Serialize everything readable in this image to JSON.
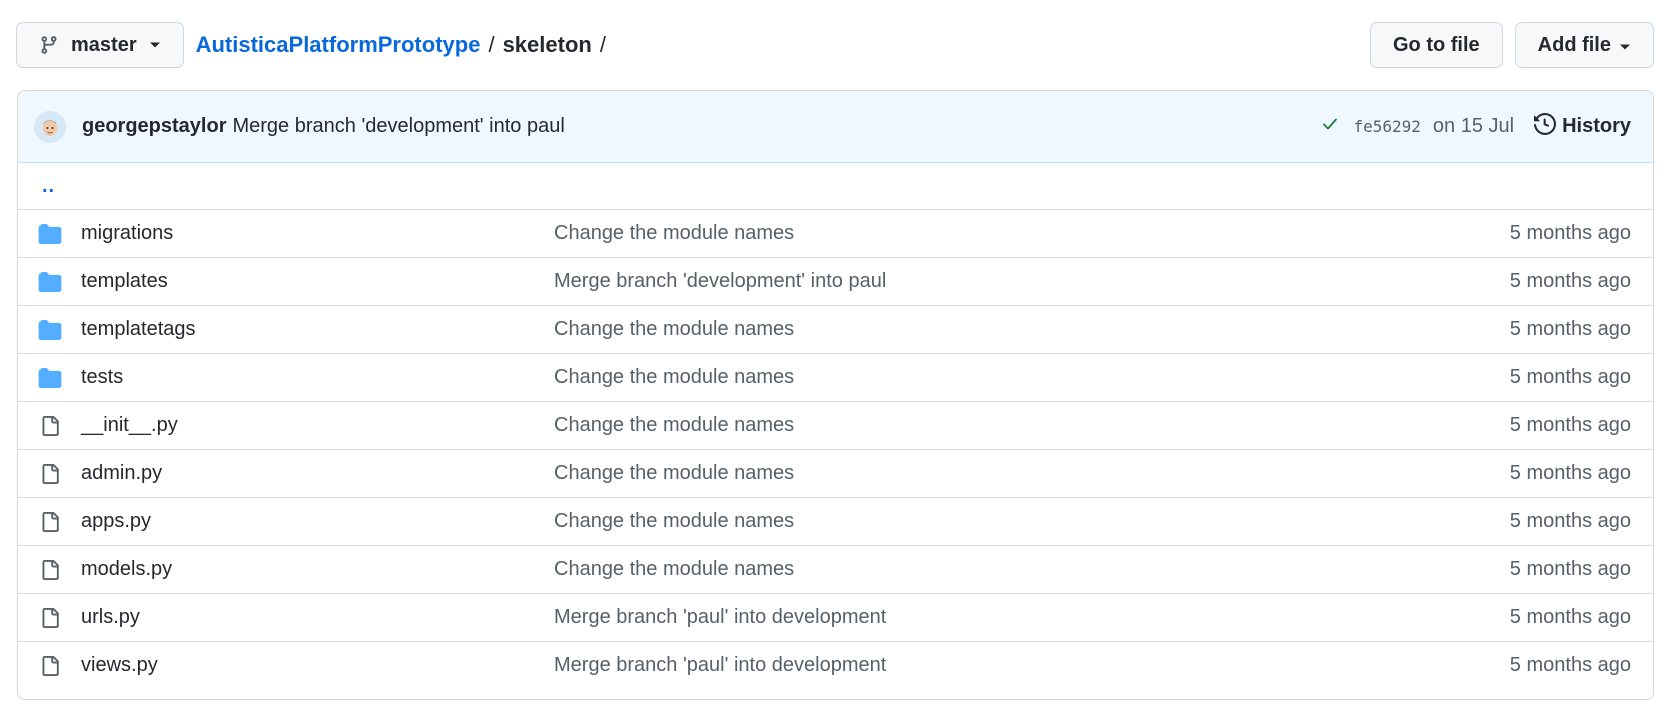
{
  "branch": {
    "label": "master"
  },
  "breadcrumb": {
    "repo": "AutisticaPlatformPrototype",
    "separator": "/",
    "dir": "skeleton",
    "trailing": "/"
  },
  "actions": {
    "go_to_file": "Go to file",
    "add_file": "Add file"
  },
  "commit": {
    "author": "georgepstaylor",
    "message": "Merge branch 'development' into paul",
    "sha": "fe56292",
    "date": "on 15 Jul",
    "history": "History"
  },
  "parent_link": "..",
  "files": [
    {
      "type": "folder",
      "name": "migrations",
      "message": "Change the module names",
      "age": "5 months ago"
    },
    {
      "type": "folder",
      "name": "templates",
      "message": "Merge branch 'development' into paul",
      "age": "5 months ago"
    },
    {
      "type": "folder",
      "name": "templatetags",
      "message": "Change the module names",
      "age": "5 months ago"
    },
    {
      "type": "folder",
      "name": "tests",
      "message": "Change the module names",
      "age": "5 months ago"
    },
    {
      "type": "file",
      "name": "__init__.py",
      "message": "Change the module names",
      "age": "5 months ago"
    },
    {
      "type": "file",
      "name": "admin.py",
      "message": "Change the module names",
      "age": "5 months ago"
    },
    {
      "type": "file",
      "name": "apps.py",
      "message": "Change the module names",
      "age": "5 months ago"
    },
    {
      "type": "file",
      "name": "models.py",
      "message": "Change the module names",
      "age": "5 months ago"
    },
    {
      "type": "file",
      "name": "urls.py",
      "message": "Merge branch 'paul' into development",
      "age": "5 months ago"
    },
    {
      "type": "file",
      "name": "views.py",
      "message": "Merge branch 'paul' into development",
      "age": "5 months ago"
    }
  ],
  "colors": {
    "link": "#0969da",
    "folder": "#54aeff",
    "success": "#1a7f37"
  }
}
